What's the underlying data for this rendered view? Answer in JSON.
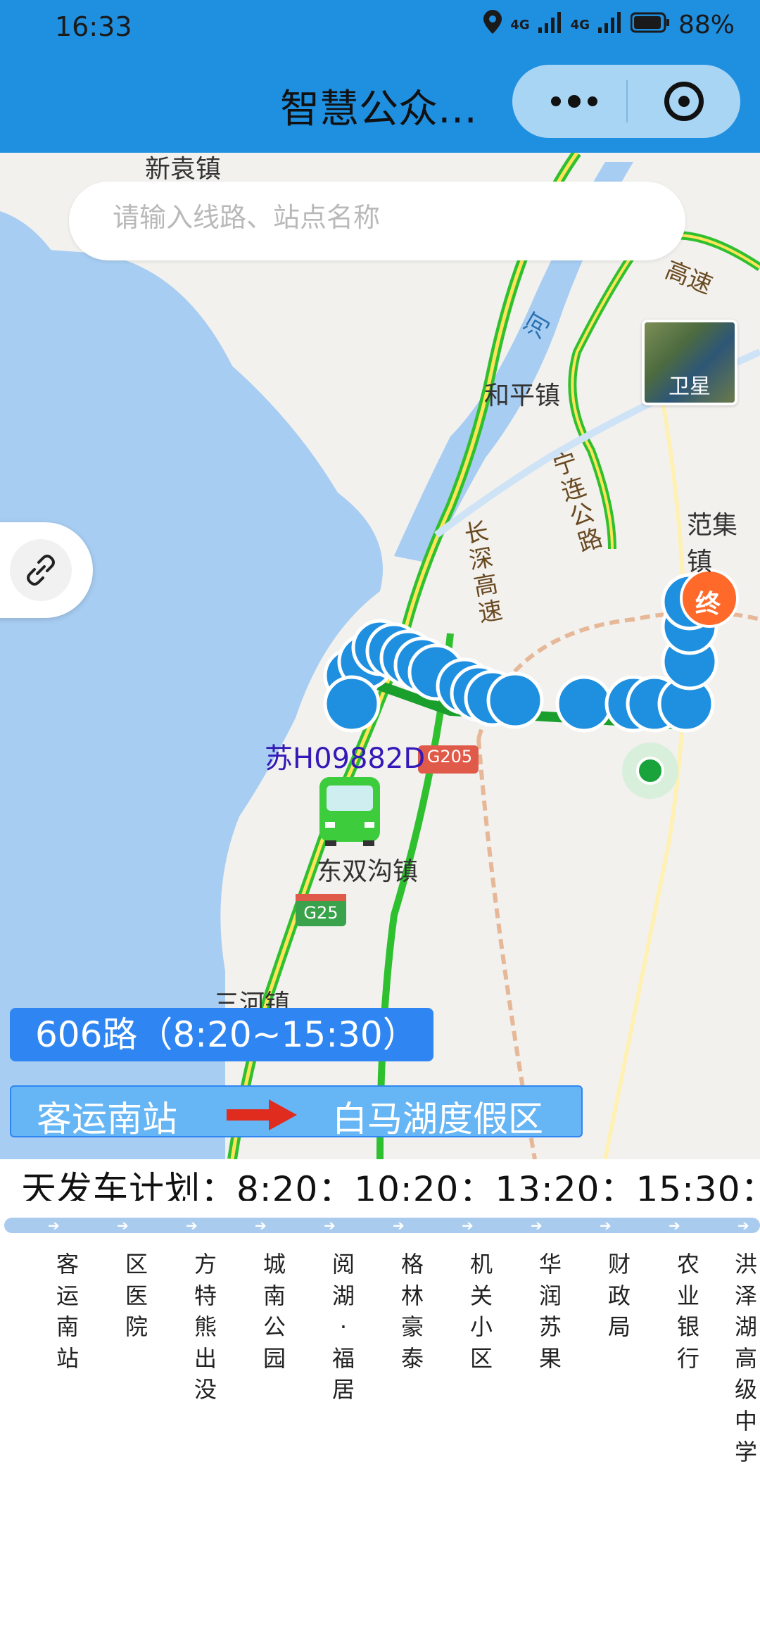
{
  "status_bar": {
    "time": "16:33",
    "network_1": "4G",
    "network_2": "4G",
    "battery": "88%"
  },
  "header": {
    "title": "智慧公众…"
  },
  "search": {
    "placeholder": "请输入线路、站点名称"
  },
  "map": {
    "place_labels": [
      "新袁镇",
      "和平镇",
      "范集镇",
      "东双沟镇",
      "三河镇"
    ],
    "road_labels": [
      "高速",
      "河",
      "宁连公路",
      "长深高速"
    ],
    "highway_shields": [
      "G205",
      "G25"
    ],
    "satellite_label": "卫星",
    "end_marker": "终",
    "bus_plate": "苏H09882D"
  },
  "route": {
    "name": "606路（8:20~15:30）",
    "from": "客运南站",
    "to": "白马湖度假区"
  },
  "schedule": {
    "text": "天发车计划：8:20：10:20：13:20：15:30："
  },
  "stops": [
    "客运南站",
    "区医院",
    "方特熊出没",
    "城南公园",
    "阅湖·福居",
    "格林豪泰",
    "机关小区",
    "华润苏果",
    "财政局",
    "农业银行",
    "洪泽湖高级中学"
  ],
  "colors": {
    "header": "#1f8fe0",
    "route_badge": "#2f86f2",
    "route_line": "#1a9e2c",
    "bus_icon": "#1f8fe0",
    "end_marker": "#ff6a2b"
  }
}
